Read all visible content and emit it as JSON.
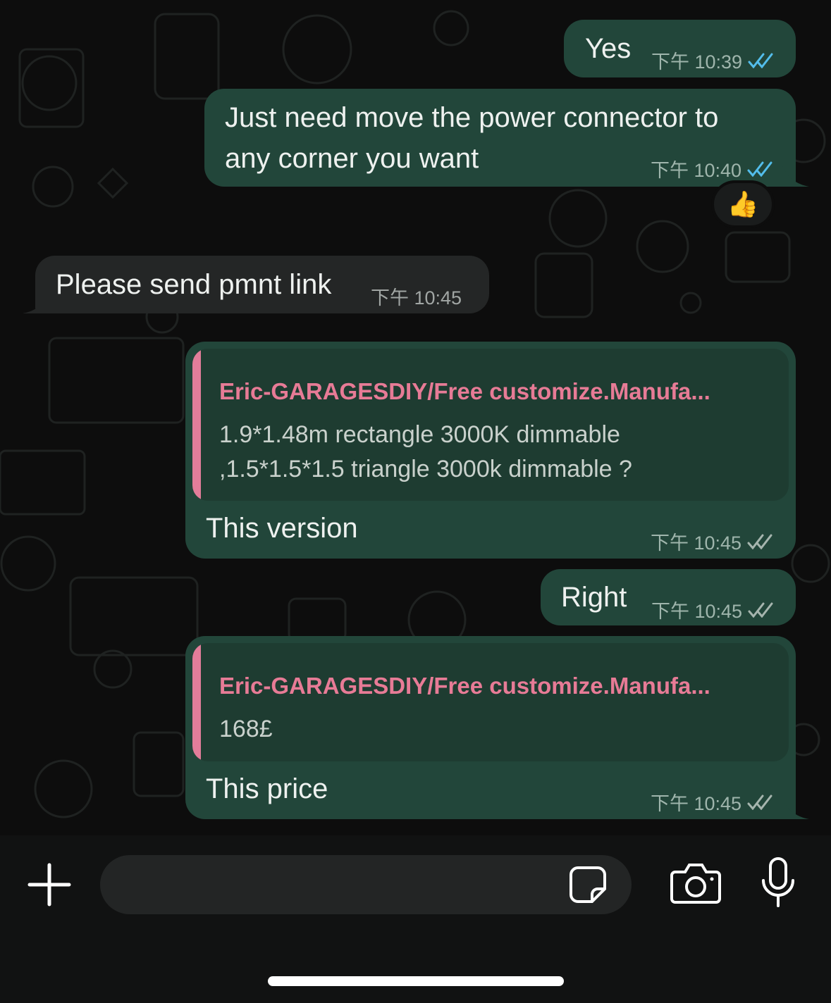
{
  "messages": [
    {
      "direction": "out",
      "text": "Yes",
      "time": "下午 10:39",
      "status": "read"
    },
    {
      "direction": "out",
      "text_lines": [
        "Just need move the power connector to",
        "any corner you want"
      ],
      "time": "下午 10:40",
      "status": "read",
      "reaction": "👍"
    },
    {
      "direction": "in",
      "text": "Please send pmnt link",
      "time": "下午 10:45"
    },
    {
      "direction": "out",
      "reply": {
        "author": "Eric-GARAGESDIY/Free customize.Manufa...",
        "lines": [
          "1.9*1.48m rectangle 3000K dimmable",
          ",1.5*1.5*1.5 triangle 3000k dimmable ?"
        ]
      },
      "text": "This version",
      "time": "下午 10:45",
      "status": "delivered"
    },
    {
      "direction": "out",
      "text": "Right",
      "time": "下午 10:45",
      "status": "delivered"
    },
    {
      "direction": "out",
      "reply": {
        "author": "Eric-GARAGESDIY/Free customize.Manufa...",
        "lines": [
          "168£"
        ]
      },
      "text": "This price",
      "time": "下午 10:45",
      "status": "delivered"
    }
  ],
  "composer": {
    "attach_icon": "plus-icon",
    "input_value": "",
    "sticker_icon": "sticker-icon",
    "camera_icon": "camera-icon",
    "mic_icon": "microphone-icon"
  },
  "colors": {
    "outgoing_bubble": "#22463a",
    "incoming_bubble": "#242626",
    "quote_author": "#e77b96",
    "read_tick": "#53bdeb",
    "delivered_tick": "#a6b5ae"
  }
}
